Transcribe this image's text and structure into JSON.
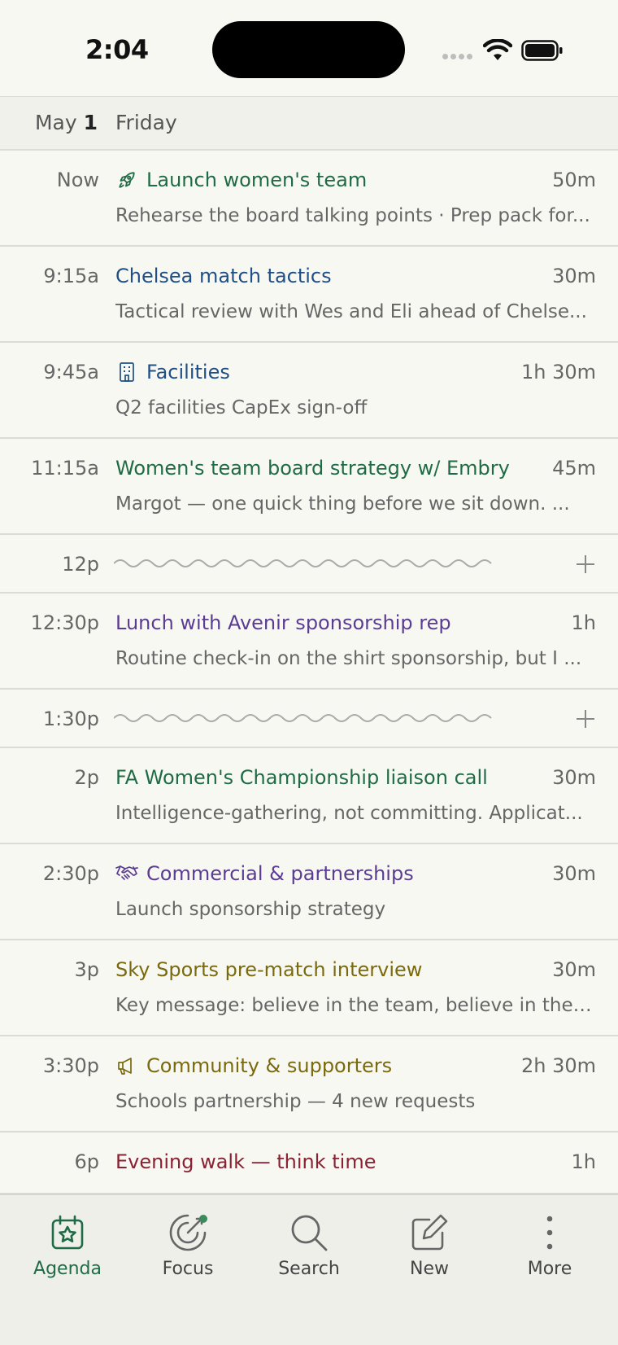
{
  "status": {
    "time": "2:04"
  },
  "day": {
    "month": "May",
    "date": "1",
    "weekday": "Friday"
  },
  "events": [
    {
      "time": "Now",
      "title": "Launch women's team",
      "duration": "50m",
      "description": "Rehearse the board talking points · Prep pack for...",
      "icon": "rocket-icon",
      "color": "#1f6b45"
    },
    {
      "time": "9:15a",
      "title": "Chelsea match tactics",
      "duration": "30m",
      "description": "Tactical review with Wes and Eli ahead of Chelse...",
      "color": "#1f4f86"
    },
    {
      "time": "9:45a",
      "title": "Facilities",
      "duration": "1h 30m",
      "description": "Q2 facilities CapEx sign-off",
      "icon": "building-icon",
      "color": "#1f4f86"
    },
    {
      "time": "11:15a",
      "title": "Women's team board strategy w/ Embry",
      "duration": "45m",
      "description": "Margot — one quick thing before we sit down. ...",
      "color": "#1f6b45"
    },
    {
      "time": "12:30p",
      "title": "Lunch with Avenir sponsorship rep",
      "duration": "1h",
      "description": "Routine check-in on the shirt sponsorship, but I ...",
      "color": "#5b3c93"
    },
    {
      "time": "2p",
      "title": "FA Women's Championship liaison call",
      "duration": "30m",
      "description": "Intelligence-gathering, not committing. Applicat...",
      "color": "#1f6b45"
    },
    {
      "time": "2:30p",
      "title": "Commercial & partnerships",
      "duration": "30m",
      "description": "Launch sponsorship strategy",
      "icon": "handshake-icon",
      "color": "#5b3c93"
    },
    {
      "time": "3p",
      "title": "Sky Sports pre-match interview",
      "duration": "30m",
      "description": "Key message: believe in the team, believe in the ...",
      "color": "#7a6a0e"
    },
    {
      "time": "3:30p",
      "title": "Community & supporters",
      "duration": "2h 30m",
      "description": "Schools partnership — 4 new requests",
      "icon": "megaphone-icon",
      "color": "#7a6a0e"
    },
    {
      "time": "6p",
      "title": "Evening walk — think time",
      "duration": "1h",
      "color": "#8a2132"
    }
  ],
  "gaps": [
    {
      "time": "12p"
    },
    {
      "time": "1:30p"
    }
  ],
  "tabs": [
    {
      "label": "Agenda",
      "icon": "calendar-star-icon",
      "active": true
    },
    {
      "label": "Focus",
      "icon": "focus-target-icon"
    },
    {
      "label": "Search",
      "icon": "search-icon"
    },
    {
      "label": "New",
      "icon": "compose-icon"
    },
    {
      "label": "More",
      "icon": "more-vertical-icon"
    }
  ]
}
